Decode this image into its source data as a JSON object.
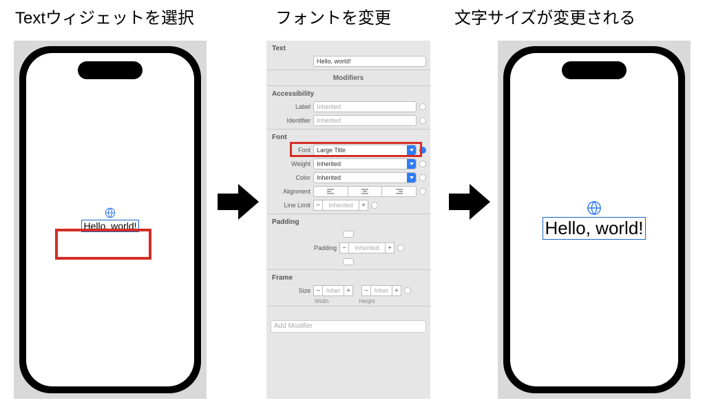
{
  "captions": {
    "step1": "Textウィジェットを選択",
    "step2": "フォントを変更",
    "step3": "文字サイズが変更される"
  },
  "widget_text_small": "Hello, world!",
  "widget_text_large": "Hello, world!",
  "inspector": {
    "sections": {
      "text": "Text",
      "modifiers": "Modifiers",
      "accessibility": "Accessibility",
      "font": "Font",
      "padding": "Padding",
      "frame": "Frame"
    },
    "text_value": "Hello, world!",
    "labels": {
      "label": "Label",
      "identifier": "Identifier",
      "font": "Font",
      "weight": "Weight",
      "color": "Color",
      "alignment": "Alignment",
      "line_limit": "Line Limit",
      "padding": "Padding",
      "size": "Size",
      "width": "Width",
      "height": "Height"
    },
    "values": {
      "font": "Large Title",
      "weight": "Inherited",
      "color": "Inherited",
      "inherited_ph": "Inherited",
      "inher_short": "Inher"
    },
    "add_modifier": "Add Modifier"
  }
}
